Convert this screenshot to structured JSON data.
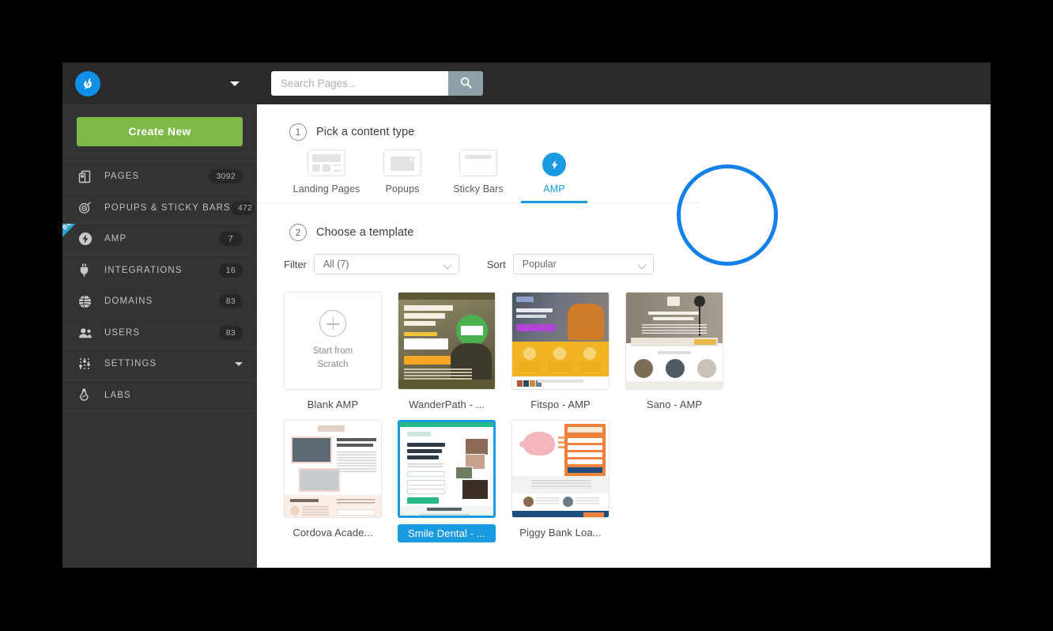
{
  "sidebar": {
    "logo_icon": "unbounce-logo-icon",
    "account_caret_icon": "chevron-down-icon",
    "create_button": "Create New",
    "items": [
      {
        "label": "PAGES",
        "badge": "3092",
        "icon": "pages-icon",
        "beta": ""
      },
      {
        "label": "POPUPS & STICKY BARS",
        "badge": "472",
        "icon": "target-icon",
        "beta": ""
      },
      {
        "label": "AMP",
        "badge": "7",
        "icon": "bolt-icon",
        "beta": "BETA"
      },
      {
        "label": "INTEGRATIONS",
        "badge": "16",
        "icon": "plug-icon",
        "beta": ""
      },
      {
        "label": "DOMAINS",
        "badge": "83",
        "icon": "globe-icon",
        "beta": ""
      },
      {
        "label": "USERS",
        "badge": "83",
        "icon": "users-icon",
        "beta": ""
      },
      {
        "label": "SETTINGS",
        "badge": "",
        "icon": "sliders-icon",
        "beta": ""
      },
      {
        "label": "LABS",
        "badge": "",
        "icon": "flask-icon",
        "beta": ""
      }
    ]
  },
  "topbar": {
    "search_placeholder": "Search Pages...",
    "search_value": "",
    "search_icon": "search-icon"
  },
  "step1": {
    "number": "1",
    "title": "Pick a content type",
    "content_types": [
      {
        "label": "Landing Pages",
        "icon": "landing-page-icon",
        "active": false
      },
      {
        "label": "Popups",
        "icon": "popup-icon",
        "active": false
      },
      {
        "label": "Sticky Bars",
        "icon": "sticky-bar-icon",
        "active": false
      },
      {
        "label": "AMP",
        "icon": "amp-bolt-icon",
        "active": true
      }
    ]
  },
  "step2": {
    "number": "2",
    "title": "Choose a template",
    "filter_label": "Filter",
    "filter_value": "All (7)",
    "sort_label": "Sort",
    "sort_value": "Popular",
    "dropdown_icon": "chevron-down-icon",
    "templates": [
      {
        "label": "Blank AMP",
        "kind": "blank",
        "line1": "Start from",
        "line2": "Scratch",
        "selected": false
      },
      {
        "label": "WanderPath - ...",
        "kind": "wander",
        "selected": false
      },
      {
        "label": "Fitspo - AMP",
        "kind": "fitspo",
        "selected": false
      },
      {
        "label": "Sano - AMP",
        "kind": "sano",
        "selected": false
      },
      {
        "label": "Cordova Acade...",
        "kind": "cordova",
        "selected": false
      },
      {
        "label": "Smile Dental - ...",
        "kind": "smile",
        "selected": true
      },
      {
        "label": "Piggy Bank Loa...",
        "kind": "piggy",
        "selected": false
      }
    ]
  },
  "annotation": {
    "highlight_icon": "circle-highlight"
  },
  "colors": {
    "accent_blue": "#1a9ae0",
    "highlight_blue": "#1480e8",
    "create_green": "#7cb947",
    "sidebar_bg": "#333333",
    "header_bg": "#2a2a2a"
  }
}
